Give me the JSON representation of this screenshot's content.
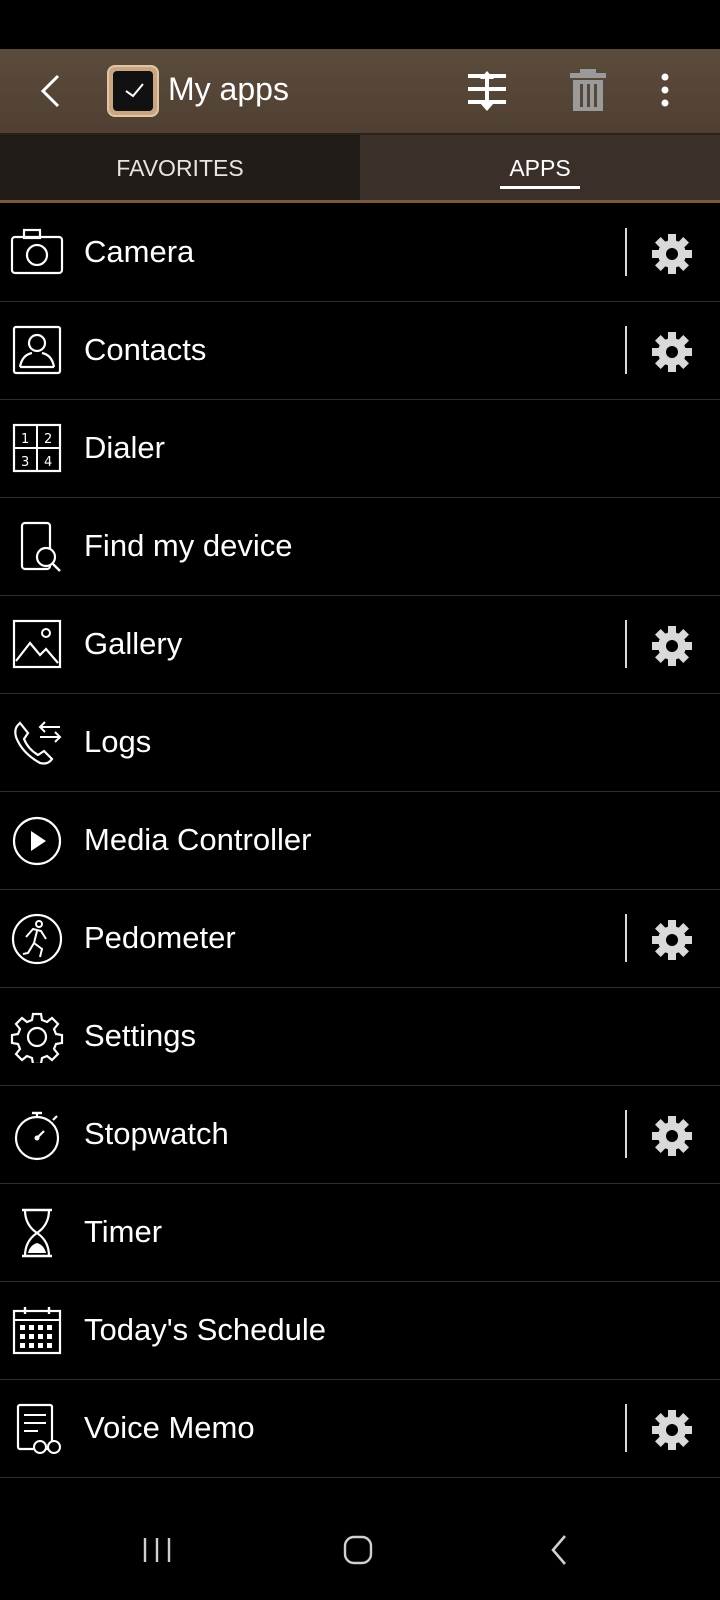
{
  "header": {
    "title": "My apps",
    "icons": [
      "back-arrow-icon",
      "watch-icon",
      "reorder-icon",
      "trash-icon",
      "more-vert-icon"
    ]
  },
  "tabs": [
    {
      "label": "FAVORITES",
      "selected": false
    },
    {
      "label": "APPS",
      "selected": true
    }
  ],
  "apps": [
    {
      "name": "Camera",
      "icon": "camera-icon",
      "settings": true
    },
    {
      "name": "Contacts",
      "icon": "contacts-icon",
      "settings": true
    },
    {
      "name": "Dialer",
      "icon": "dialer-icon",
      "settings": false
    },
    {
      "name": "Find my device",
      "icon": "find-device-icon",
      "settings": false
    },
    {
      "name": "Gallery",
      "icon": "gallery-icon",
      "settings": true
    },
    {
      "name": "Logs",
      "icon": "logs-icon",
      "settings": false
    },
    {
      "name": "Media Controller",
      "icon": "play-icon",
      "settings": false
    },
    {
      "name": "Pedometer",
      "icon": "pedometer-icon",
      "settings": true
    },
    {
      "name": "Settings",
      "icon": "settings-icon",
      "settings": false
    },
    {
      "name": "Stopwatch",
      "icon": "stopwatch-icon",
      "settings": true
    },
    {
      "name": "Timer",
      "icon": "hourglass-icon",
      "settings": false
    },
    {
      "name": "Today's Schedule",
      "icon": "calendar-icon",
      "settings": false
    },
    {
      "name": "Voice Memo",
      "icon": "voice-memo-icon",
      "settings": true
    }
  ],
  "colors": {
    "app_bar": "#574737",
    "tab_selected_bg": "#3a3029",
    "tab_unselected_bg": "#221c18",
    "accent": "#7a5a3a"
  },
  "nav": {
    "icons": [
      "recents-icon",
      "home-icon",
      "back-icon"
    ]
  }
}
